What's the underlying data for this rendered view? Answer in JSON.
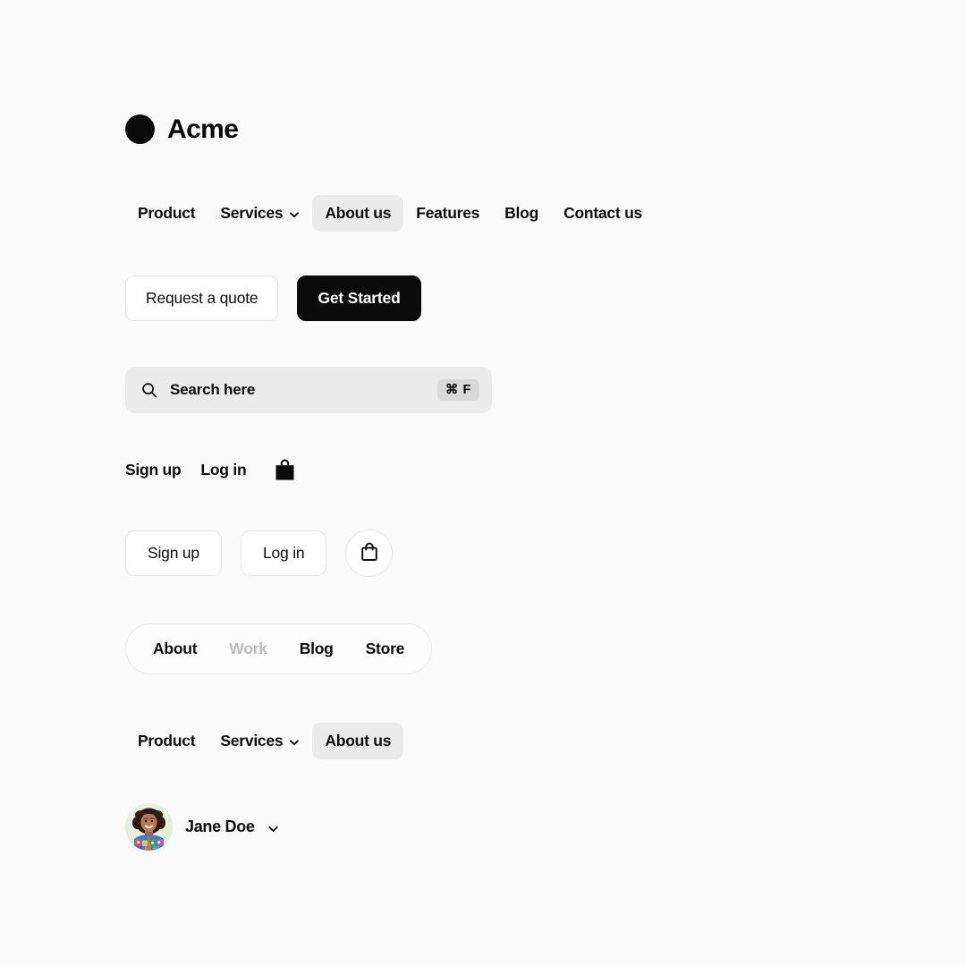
{
  "brand": {
    "name": "Acme",
    "logo_icon": "circle-logo-icon"
  },
  "primary_nav": {
    "items": [
      {
        "label": "Product",
        "active": false,
        "has_chevron": false
      },
      {
        "label": "Services",
        "active": false,
        "has_chevron": true
      },
      {
        "label": "About us",
        "active": true,
        "has_chevron": false
      },
      {
        "label": "Features",
        "active": false,
        "has_chevron": false
      },
      {
        "label": "Blog",
        "active": false,
        "has_chevron": false
      },
      {
        "label": "Contact us",
        "active": false,
        "has_chevron": false
      }
    ]
  },
  "cta_buttons": {
    "secondary_label": "Request a quote",
    "primary_label": "Get Started",
    "primary_bg": "#0b0b0b",
    "primary_text_color": "#ffffff"
  },
  "search": {
    "placeholder": "Search here",
    "shortcut": "⌘ F",
    "icon": "search-icon",
    "background": "#ebebeb"
  },
  "auth_links": {
    "signup_label": "Sign up",
    "login_label": "Log in",
    "cart_icon": "shopping-bag-filled-icon"
  },
  "auth_buttons": {
    "signup_label": "Sign up",
    "login_label": "Log in",
    "cart_icon": "shopping-bag-outline-icon"
  },
  "segmented_nav": {
    "items": [
      {
        "label": "About",
        "disabled": false
      },
      {
        "label": "Work",
        "disabled": true
      },
      {
        "label": "Blog",
        "disabled": false
      },
      {
        "label": "Store",
        "disabled": false
      }
    ],
    "disabled_color": "#bcbcbc"
  },
  "secondary_nav": {
    "items": [
      {
        "label": "Product",
        "active": false,
        "has_chevron": false
      },
      {
        "label": "Services",
        "active": false,
        "has_chevron": true
      },
      {
        "label": "About us",
        "active": true,
        "has_chevron": false
      }
    ]
  },
  "account": {
    "name": "Jane Doe",
    "avatar_icon": "user-avatar-photo",
    "chevron_icon": "chevron-down-icon"
  },
  "theme": {
    "page_background": "#fafafa",
    "text_color": "#0d0d0d",
    "active_pill": "#ebebeb",
    "border": "#e6e6e6"
  }
}
